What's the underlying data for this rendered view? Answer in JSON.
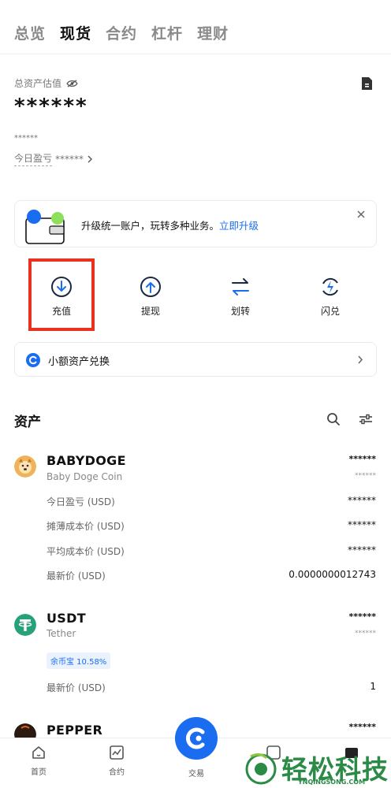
{
  "tabs": [
    "总览",
    "现货",
    "合约",
    "杠杆",
    "理财"
  ],
  "header": {
    "asset_label": "总资产估值",
    "total_value": "******",
    "sub_value": "******",
    "pnl_label": "今日盈亏",
    "pnl_value": "******"
  },
  "banner": {
    "text": "升级统一账户，玩转多种业务。",
    "link": "立即升级"
  },
  "actions": {
    "deposit": "充值",
    "withdraw": "提现",
    "transfer": "划转",
    "flash": "闪兑"
  },
  "exchange": {
    "label": "小额资产兑换"
  },
  "assets": {
    "title": "资产",
    "coins": [
      {
        "symbol": "BABYDOGE",
        "name": "Baby Doge Coin",
        "value": "******",
        "sub_value": "******",
        "rows": [
          {
            "label": "今日盈亏 (USD)",
            "value": "******"
          },
          {
            "label": "摊薄成本价 (USD)",
            "value": "******"
          },
          {
            "label": "平均成本价 (USD)",
            "value": "******"
          },
          {
            "label": "最新价 (USD)",
            "value": "0.0000000012743"
          }
        ]
      },
      {
        "symbol": "USDT",
        "name": "Tether",
        "value": "******",
        "sub_value": "******",
        "tag": "余币宝 10.58%",
        "rows": [
          {
            "label": "最新价 (USD)",
            "value": "1"
          }
        ]
      },
      {
        "symbol": "PEPPER",
        "value": "******"
      }
    ]
  },
  "bottom_nav": {
    "home": "首页",
    "contract": "合约",
    "trade": "交易"
  },
  "watermark": {
    "text": "轻松科技",
    "url": "YNQINGSONG.COM"
  },
  "colors": {
    "accent": "#1a6cf0",
    "highlight": "#e8321f",
    "usdt": "#26a17b",
    "watermark": "#2a8a46"
  }
}
